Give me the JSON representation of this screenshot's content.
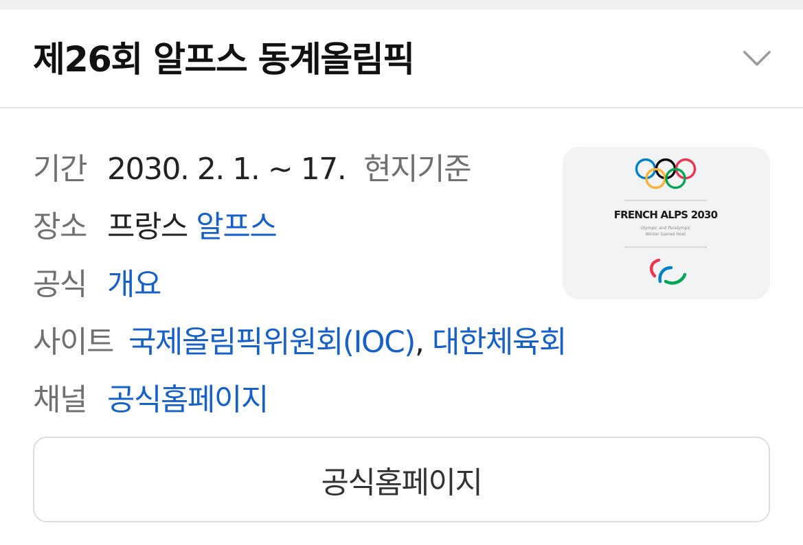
{
  "header": {
    "title": "제26회 알프스 동계올림픽"
  },
  "info": {
    "period": {
      "label": "기간",
      "value": "2030. 2. 1. ~ 17.",
      "note": "현지기준"
    },
    "venue": {
      "label": "장소",
      "value": "프랑스",
      "link": "알프스"
    },
    "official": {
      "label": "공식",
      "link": "개요"
    },
    "site": {
      "label": "사이트",
      "link1": "국제올림픽위원회(IOC)",
      "separator": ",",
      "link2": "대한체육회"
    },
    "channel": {
      "label": "채널",
      "link": "공식홈페이지"
    }
  },
  "logo": {
    "text": "FRENCH ALPS 2030",
    "subtext_line1": "Olympic and Paralympic",
    "subtext_line2": "Winter Games Host"
  },
  "button": {
    "label": "공식홈페이지"
  },
  "colors": {
    "link": "#1660c9",
    "label": "#707070",
    "olympic_blue": "#0081c8",
    "olympic_yellow": "#fcb131",
    "olympic_black": "#000000",
    "olympic_green": "#00a651",
    "olympic_red": "#ee334e"
  }
}
